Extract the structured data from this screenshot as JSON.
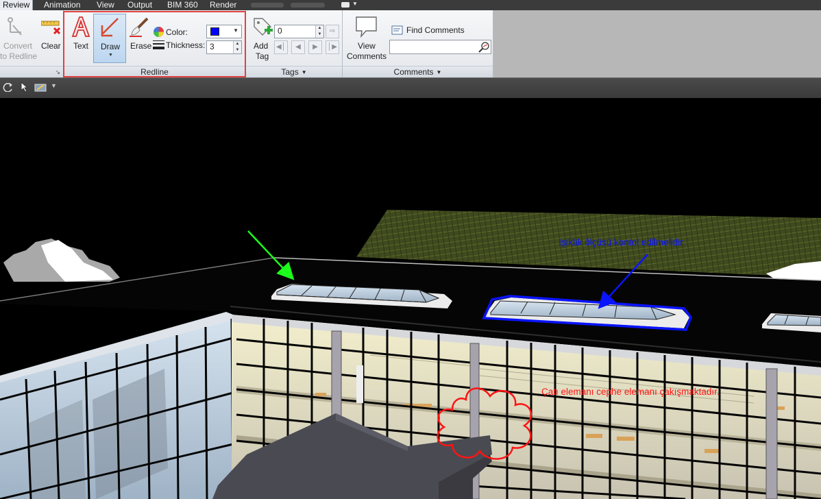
{
  "tabs": {
    "review": "Review",
    "animation": "Animation",
    "view": "View",
    "output": "Output",
    "bim360": "BIM 360",
    "render": "Render"
  },
  "redline_panel": {
    "convert_label_1": "Convert",
    "convert_label_2": "to Redline",
    "clear_label": "Clear",
    "text_label": "Text",
    "draw_label": "Draw",
    "erase_label": "Erase",
    "color_label": "Color:",
    "thickness_label": "Thickness:",
    "thickness_value": "3",
    "color_value": "#0000ff",
    "title": "Redline"
  },
  "tags_panel": {
    "add_label_1": "Add",
    "add_label_2": "Tag",
    "tag_number": "0",
    "title": "Tags"
  },
  "comments_panel": {
    "view_label_1": "View",
    "view_label_2": "Comments",
    "find_label": "Find Comments",
    "search_value": "",
    "title": "Comments"
  },
  "annotations": {
    "blue_note": "Işıklık ölçüsü kontol edilmelidir.",
    "red_note": "Çatı elemanı cephe elemanı çakışmaktadır.",
    "blue_color": "#0a14ff",
    "red_color": "#ff1414",
    "green_color": "#1cff1c"
  }
}
